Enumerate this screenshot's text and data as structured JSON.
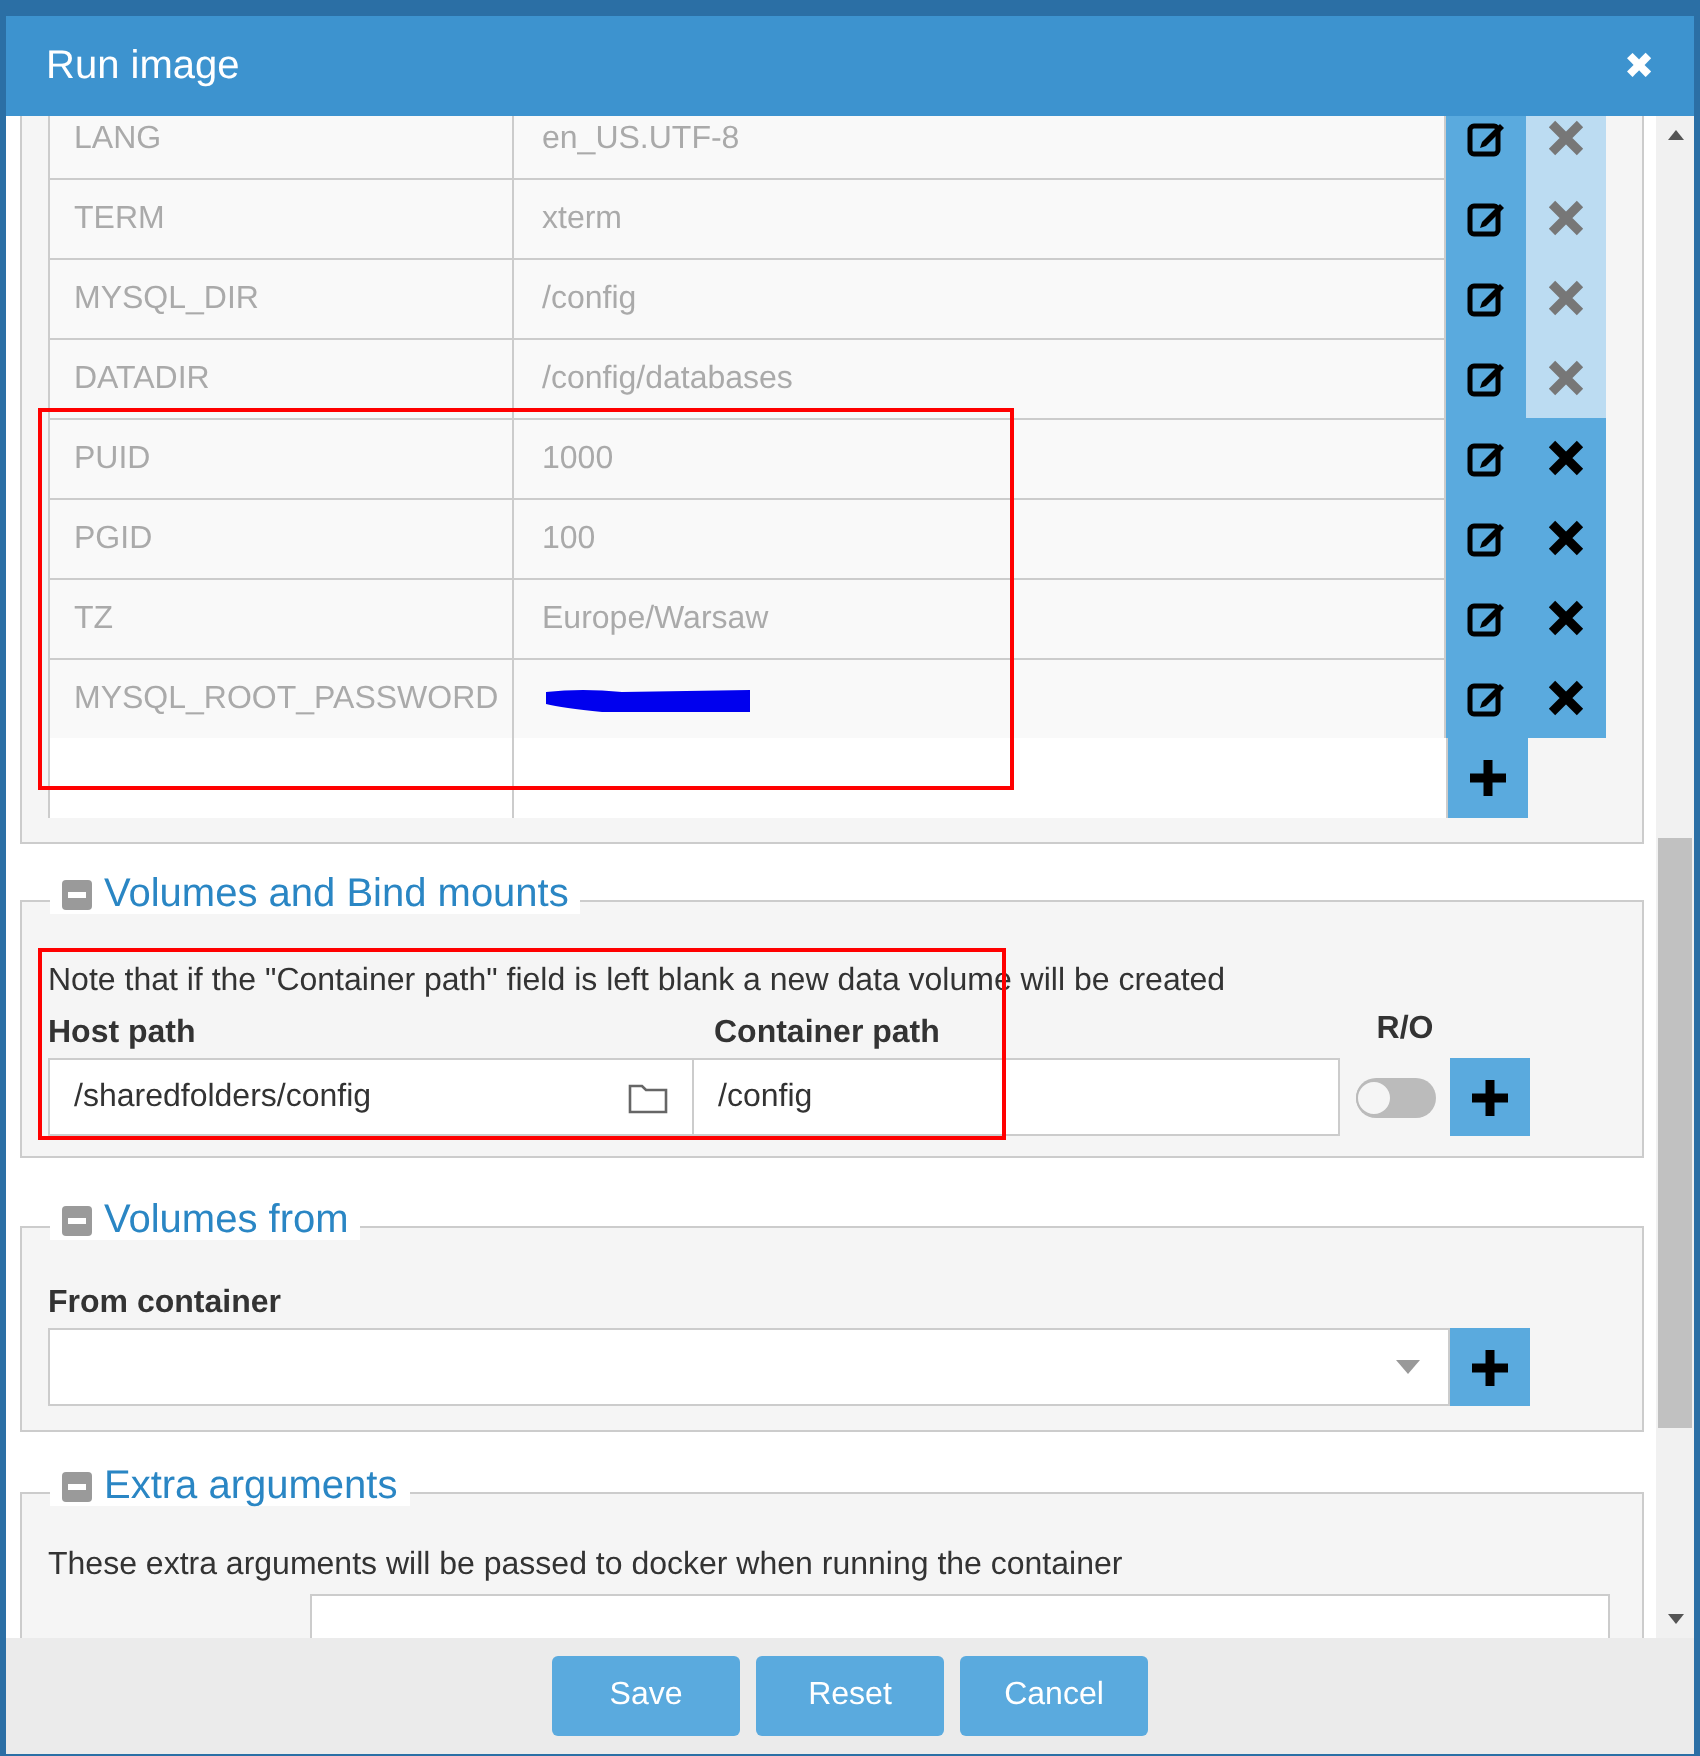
{
  "window": {
    "title": "Run image",
    "close": "✖"
  },
  "env": {
    "rows": [
      {
        "name": "LANG",
        "value": "en_US.UTF-8",
        "removable": false
      },
      {
        "name": "TERM",
        "value": "xterm",
        "removable": false
      },
      {
        "name": "MYSQL_DIR",
        "value": "/config",
        "removable": false
      },
      {
        "name": "DATADIR",
        "value": "/config/databases",
        "removable": false
      },
      {
        "name": "PUID",
        "value": "1000",
        "removable": true
      },
      {
        "name": "PGID",
        "value": "100",
        "removable": true
      },
      {
        "name": "TZ",
        "value": "Europe/Warsaw",
        "removable": true
      },
      {
        "name": "MYSQL_ROOT_PASSWORD",
        "redacted": true,
        "removable": true
      }
    ]
  },
  "volumes": {
    "title": "Volumes and Bind mounts",
    "note": "Note that if the \"Container path\" field is left blank a new data volume will be created",
    "host_label": "Host path",
    "container_label": "Container path",
    "ro_label": "R/O",
    "host_value": "/sharedfolders/config",
    "container_value": "/config",
    "read_only": false
  },
  "volumes_from": {
    "title": "Volumes from",
    "label": "From container"
  },
  "extra": {
    "title": "Extra arguments",
    "note": "These extra arguments will be passed to docker when running the container"
  },
  "annotations": [
    {
      "kind": "rectangle",
      "color": "#ff0000"
    },
    {
      "kind": "rectangle",
      "color": "#ff0000"
    }
  ],
  "buttons": [
    "Save",
    "Reset",
    "Cancel"
  ]
}
